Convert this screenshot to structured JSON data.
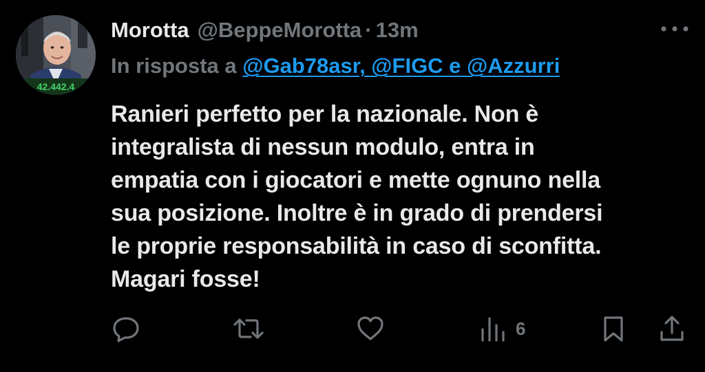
{
  "tweet": {
    "display_name": "Morotta",
    "handle": "@BeppeMorotta",
    "separator": "·",
    "time": "13m",
    "reply_prefix": "In risposta a",
    "reply_mentions": "@Gab78asr, @FIGC e @Azzurri",
    "text": "Ranieri perfetto per la nazionale. Non è\nintegralista di nessun modulo, entra in\nempatia con i giocatori e mette ognuno nella\nsua posizione. Inoltre è in grado di prendersi\nle proprie responsabilità in caso di sconfitta.\nMagari fosse!",
    "avatar_caption": "42.442.4"
  },
  "actions": {
    "reply_icon": "comment-icon",
    "retweet_icon": "retweet-icon",
    "like_icon": "heart-icon",
    "views_icon": "analytics-icon",
    "views_count": "6",
    "bookmark_icon": "bookmark-icon",
    "share_icon": "share-icon",
    "more_icon": "more-dots-icon"
  },
  "colors": {
    "background": "#000000",
    "text_primary": "#e7e9ea",
    "text_secondary": "#71767b",
    "link": "#1d9bf0"
  }
}
